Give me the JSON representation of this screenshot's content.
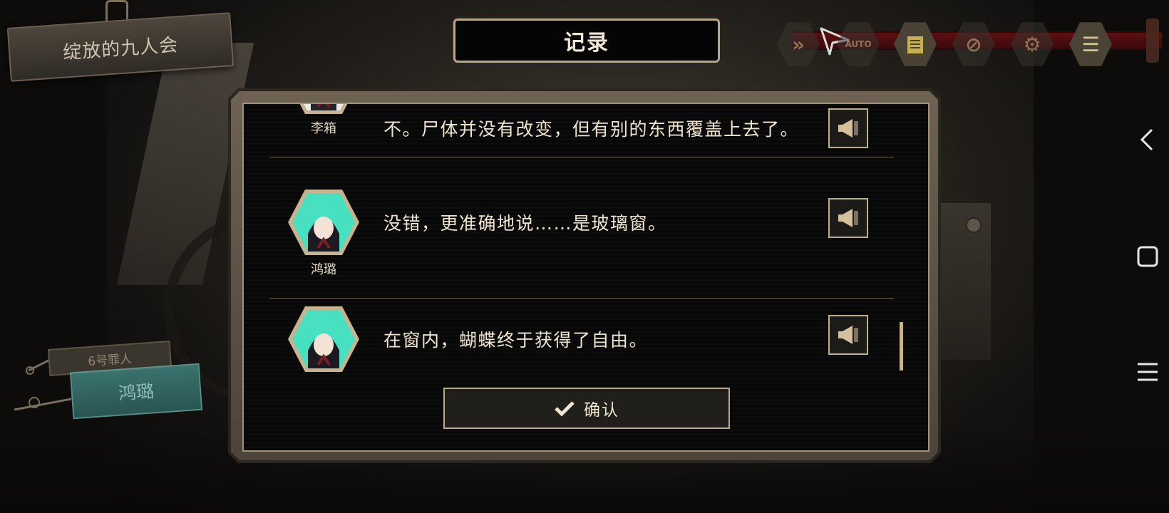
{
  "game": {
    "title": "绽放的九人会"
  },
  "header": {
    "title": "记录"
  },
  "toolbar": {
    "buttons": [
      {
        "name": "fast-forward",
        "glyph": "⏩",
        "active": false
      },
      {
        "name": "send",
        "glyph": "➤",
        "active": false
      },
      {
        "name": "auto",
        "glyph": "AUTO",
        "active": false
      },
      {
        "name": "log",
        "glyph": "▤",
        "active": true
      },
      {
        "name": "hide-ui",
        "glyph": "⊘",
        "active": false
      },
      {
        "name": "settings",
        "glyph": "⚙",
        "active": false
      },
      {
        "name": "menu",
        "glyph": "☰",
        "active": true
      }
    ]
  },
  "character": {
    "sinner_label": "6号罪人",
    "name": "鸿璐"
  },
  "log": {
    "entries": [
      {
        "speaker": "李箱",
        "line": "不。尸体并没有改变，但有别的东西覆盖上去了。"
      },
      {
        "speaker": "鸿璐",
        "line": "没错，更准确地说……是玻璃窗。"
      },
      {
        "speaker": "",
        "line": "在窗内，蝴蝶终于获得了自由。"
      }
    ],
    "confirm_label": "确认"
  },
  "colors": {
    "frame": "#bba98a",
    "rail": "#5c0f12",
    "teal": "#3f7d78",
    "avatar_bg": "#47e0c1"
  }
}
